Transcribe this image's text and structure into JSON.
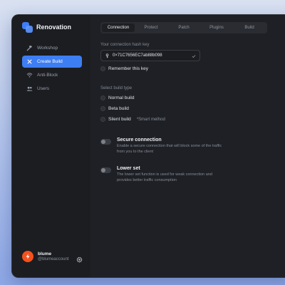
{
  "app": {
    "name": "Renovation"
  },
  "sidebar": {
    "items": [
      {
        "label": "Workshop",
        "icon": "hammer-icon",
        "active": false
      },
      {
        "label": "Create Build",
        "icon": "tools-icon",
        "active": true
      },
      {
        "label": "Anti-Block",
        "icon": "wifi-icon",
        "active": false
      },
      {
        "label": "Users",
        "icon": "users-icon",
        "active": false
      }
    ]
  },
  "user": {
    "name": "blume",
    "handle": "@blumeaccount",
    "avatar_color": "#f4511e"
  },
  "tabs": [
    "Connection",
    "Protect",
    "Patch",
    "Plugins",
    "Build"
  ],
  "active_tab": "Connection",
  "connection": {
    "hash_label": "Your connection hash key",
    "hash_value": "0×71C7656EC7ab88b098",
    "remember_label": "Remember this key"
  },
  "build_type": {
    "label": "Select build type",
    "options": [
      {
        "label": "Normal build",
        "hint": ""
      },
      {
        "label": "Beta build",
        "hint": ""
      },
      {
        "label": "Silent build",
        "hint": "*Smart method"
      }
    ]
  },
  "toggles": [
    {
      "title": "Secure connection",
      "description": "Enable a secure connection that will block some of the traffic from you to the client"
    },
    {
      "title": "Lower set",
      "description": "The lower set function is used for weak connection and provides better traffic consumption"
    }
  ],
  "colors": {
    "accent": "#3e7ef3",
    "background": "#1e2025",
    "sidebar": "#1b1d21"
  }
}
